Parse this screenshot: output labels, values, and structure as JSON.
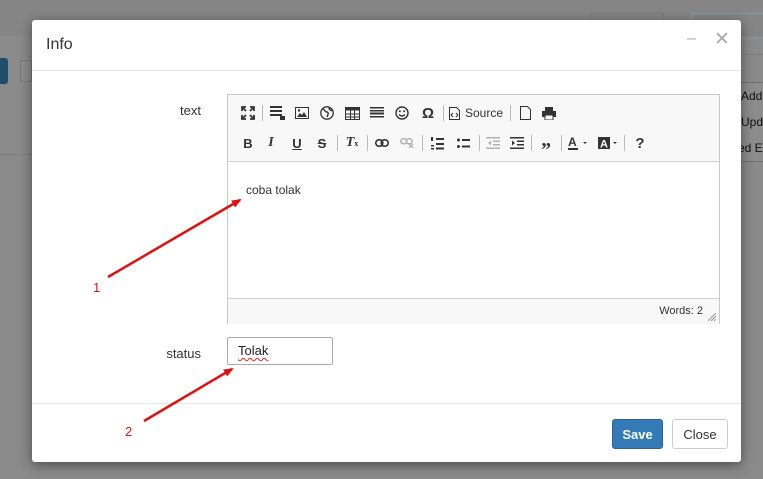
{
  "background": {
    "menu_items": [
      "Add",
      "Upd",
      "ed E"
    ]
  },
  "modal": {
    "title": "Info",
    "fields": {
      "text_label": "text",
      "status_label": "status"
    },
    "editor": {
      "source_label": "Source",
      "content": "coba tolak",
      "word_count": "Words: 2"
    },
    "status_value": "Tolak",
    "buttons": {
      "save": "Save",
      "close": "Close"
    }
  },
  "annotations": {
    "labels": [
      "1",
      "2"
    ],
    "color": "#e01010"
  },
  "colors": {
    "primary": "#337ab7",
    "annotation": "#e01010"
  }
}
